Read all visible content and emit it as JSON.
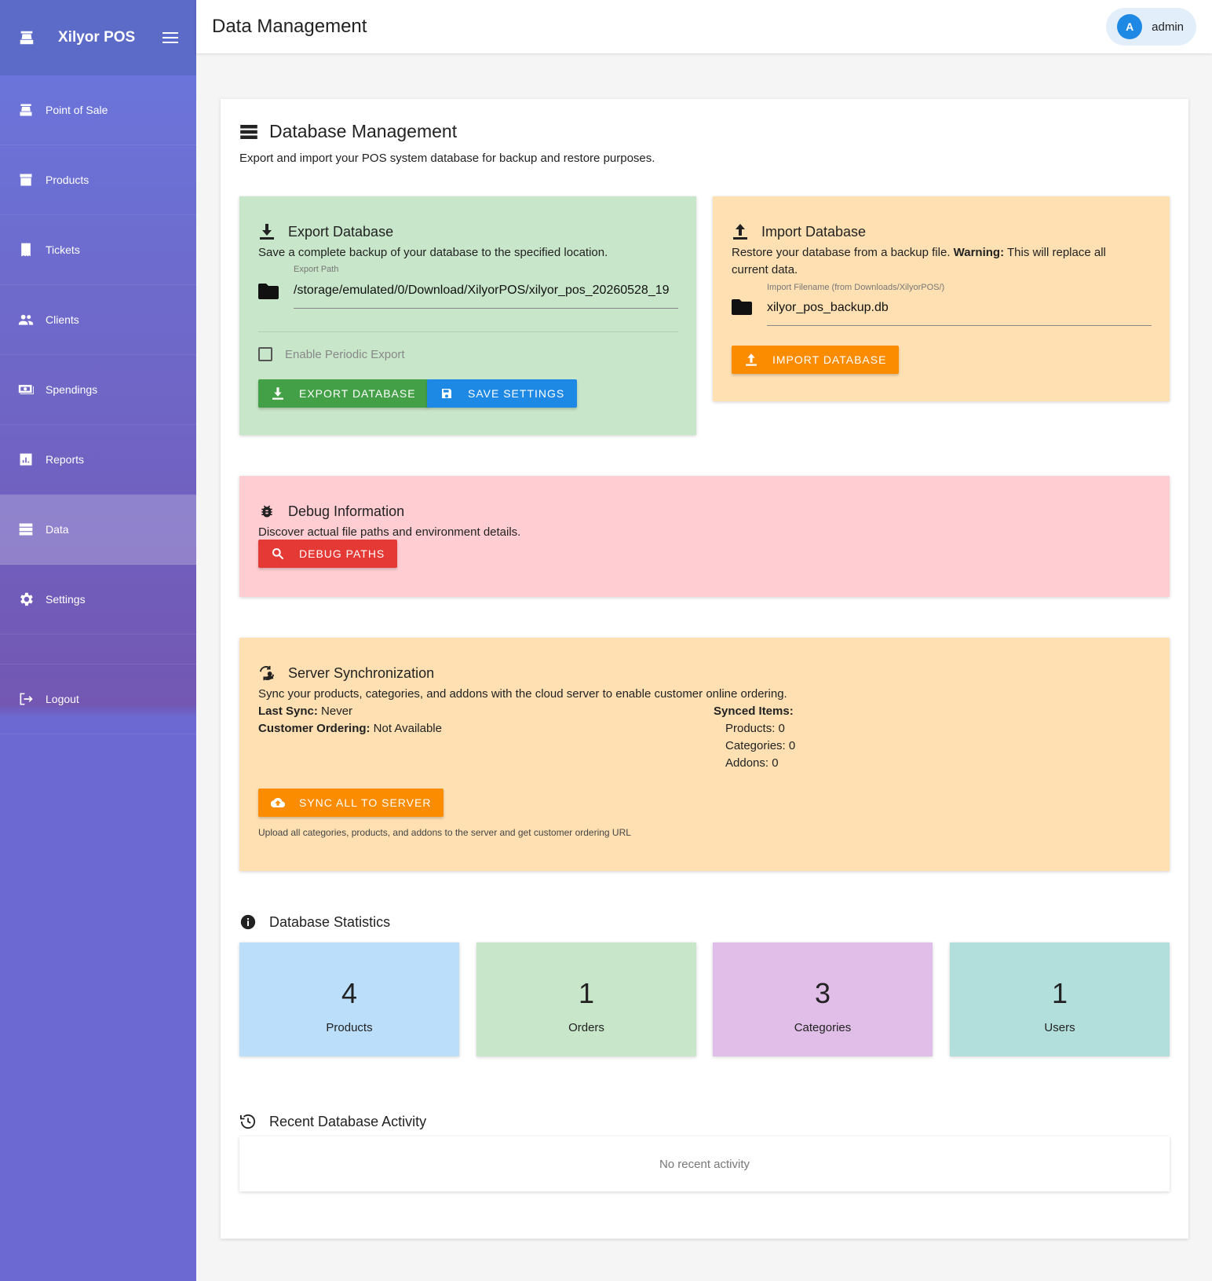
{
  "app": {
    "name": "Xilyor POS"
  },
  "sidebar": {
    "items": [
      {
        "label": "Point of Sale",
        "icon": "cash-register-icon"
      },
      {
        "label": "Products",
        "icon": "archive-icon"
      },
      {
        "label": "Tickets",
        "icon": "receipt-icon"
      },
      {
        "label": "Clients",
        "icon": "people-icon"
      },
      {
        "label": "Spendings",
        "icon": "cash-icon"
      },
      {
        "label": "Reports",
        "icon": "chart-icon"
      },
      {
        "label": "Data",
        "icon": "database-icon",
        "active": true
      },
      {
        "label": "Settings",
        "icon": "gear-icon"
      }
    ],
    "logout_label": "Logout"
  },
  "topbar": {
    "title": "Data Management",
    "user_initial": "A",
    "user_name": "admin"
  },
  "db": {
    "title": "Database Management",
    "subtitle": "Export and import your POS system database for backup and restore purposes."
  },
  "export": {
    "title": "Export Database",
    "description": "Save a complete backup of your database to the specified location.",
    "path_label": "Export Path",
    "path_value": "/storage/emulated/0/Download/XilyorPOS/xilyor_pos_20260528_19",
    "periodic_label": "Enable Periodic Export",
    "periodic_checked": false,
    "export_button": "EXPORT DATABASE",
    "save_button": "SAVE SETTINGS",
    "color": "#c8e6c9"
  },
  "import": {
    "title": "Import Database",
    "description_pre": "Restore your database from a backup file. ",
    "warning_label": "Warning:",
    "description_post": " This will replace all current data.",
    "filename_label": "Import Filename (from Downloads/XilyorPOS/)",
    "filename_value": "xilyor_pos_backup.db",
    "import_button": "IMPORT DATABASE",
    "color": "#ffe0b2"
  },
  "debug": {
    "title": "Debug Information",
    "description": "Discover actual file paths and environment details.",
    "button": "DEBUG PATHS",
    "color": "#ffcdd2"
  },
  "sync": {
    "title": "Server Synchronization",
    "description": "Sync your products, categories, and addons with the cloud server to enable customer online ordering.",
    "last_sync_label": "Last Sync:",
    "last_sync_value": " Never",
    "ordering_label": "Customer Ordering:",
    "ordering_value": " Not Available",
    "synced_label": "Synced Items:",
    "synced_products": "Products: 0",
    "synced_categories": "Categories: 0",
    "synced_addons": "Addons: 0",
    "button": "SYNC ALL TO SERVER",
    "hint": "Upload all categories, products, and addons to the server and get customer ordering URL",
    "color": "#ffe0b2"
  },
  "stats": {
    "title": "Database Statistics",
    "items": [
      {
        "value": "4",
        "label": "Products",
        "color": "#bbdefb"
      },
      {
        "value": "1",
        "label": "Orders",
        "color": "#c8e6c9"
      },
      {
        "value": "3",
        "label": "Categories",
        "color": "#e1bee7"
      },
      {
        "value": "1",
        "label": "Users",
        "color": "#b2dfdb"
      }
    ]
  },
  "activity": {
    "title": "Recent Database Activity",
    "empty_text": "No recent activity"
  }
}
